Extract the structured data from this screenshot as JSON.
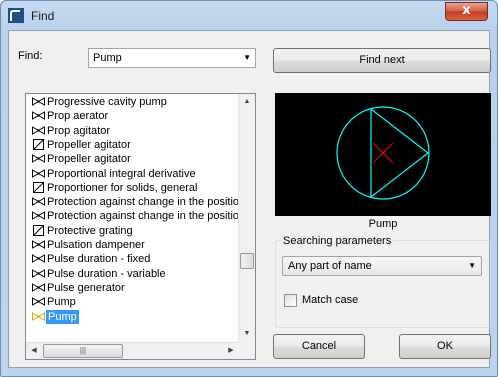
{
  "window": {
    "title": "Find",
    "close_glyph": "x"
  },
  "find": {
    "label": "Find:",
    "value": "Pump"
  },
  "buttons": {
    "find_next": "Find next",
    "cancel": "Cancel",
    "ok": "OK"
  },
  "list": {
    "items": [
      {
        "label": "Progressive cavity pump",
        "icon": "pump-symbol-icon"
      },
      {
        "label": "Prop aerator",
        "icon": "pump-symbol-icon"
      },
      {
        "label": "Prop agitator",
        "icon": "pump-symbol-icon"
      },
      {
        "label": "Propeller agitator",
        "icon": "box-symbol-icon"
      },
      {
        "label": "Propeller agitator",
        "icon": "pump-symbol-icon"
      },
      {
        "label": "Proportional integral derivative",
        "icon": "pump-symbol-icon"
      },
      {
        "label": "Proportioner for solids, general",
        "icon": "box-symbol-icon"
      },
      {
        "label": "Protection against change in the position",
        "icon": "pump-symbol-icon"
      },
      {
        "label": "Protection against change in the position",
        "icon": "pump-symbol-icon"
      },
      {
        "label": "Protective grating",
        "icon": "box-symbol-icon"
      },
      {
        "label": "Pulsation dampener",
        "icon": "pump-symbol-icon"
      },
      {
        "label": "Pulse duration - fixed",
        "icon": "pump-symbol-icon"
      },
      {
        "label": "Pulse duration - variable",
        "icon": "pump-symbol-icon"
      },
      {
        "label": "Pulse generator",
        "icon": "pump-symbol-icon"
      },
      {
        "label": "Pump",
        "icon": "pump-symbol-icon"
      },
      {
        "label": "Pump",
        "icon": "pump-symbol-icon",
        "selected": true
      }
    ]
  },
  "preview": {
    "label": "Pump",
    "symbol_color": "#00ffff",
    "center_mark_color": "#ff0000"
  },
  "search_params": {
    "title": "Searching parameters",
    "mode": "Any part of name",
    "match_case_label": "Match case",
    "match_case_checked": false
  },
  "colors": {
    "selection": "#3399ff",
    "window_frame": "#bcd3ee",
    "close_button": "#c23b1f"
  }
}
